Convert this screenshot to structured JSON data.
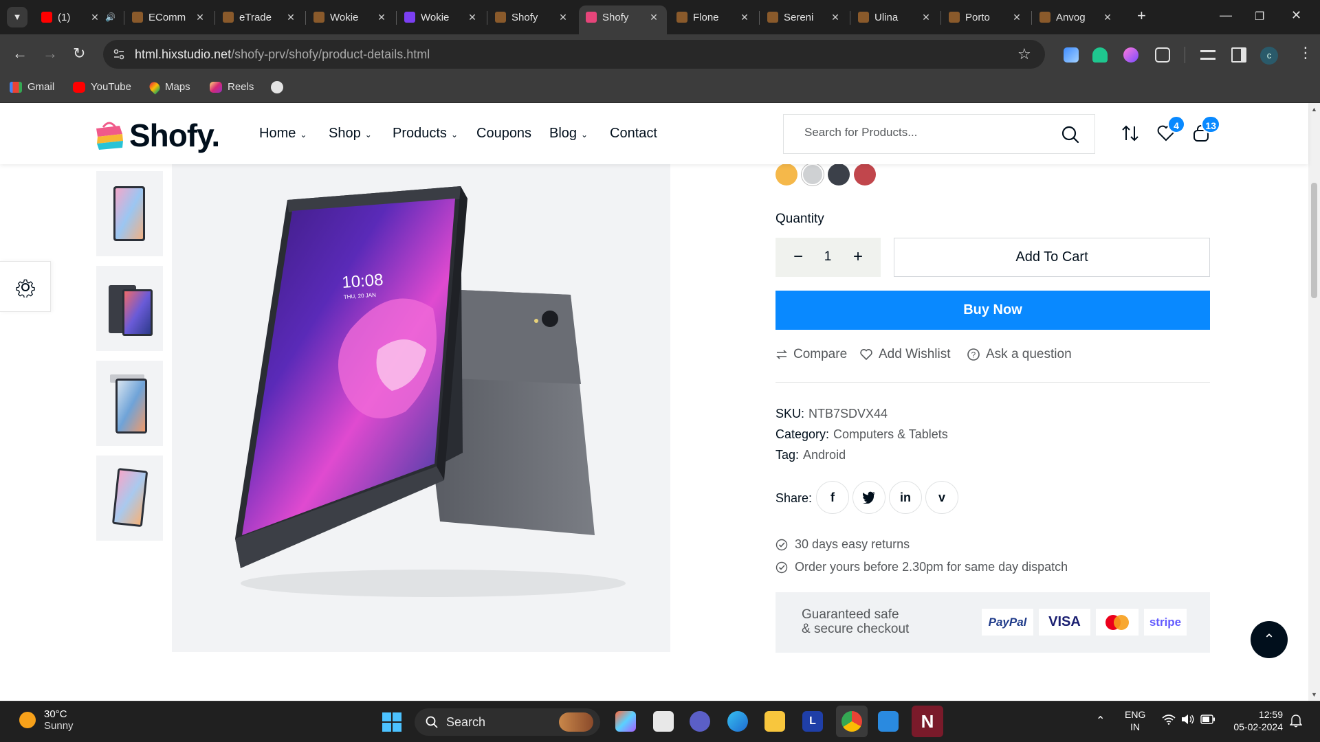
{
  "browser": {
    "tabs": [
      {
        "label": "(1)",
        "icon_color": "#ff0000"
      },
      {
        "label": "EComm",
        "icon_color": "#8a5a2b"
      },
      {
        "label": "eTrade",
        "icon_color": "#8a5a2b"
      },
      {
        "label": "Wokie",
        "icon_color": "#8a5a2b"
      },
      {
        "label": "Wokie",
        "icon_color": "#7b3ff2"
      },
      {
        "label": "Shofy",
        "icon_color": "#8a5a2b"
      },
      {
        "label": "Shofy",
        "icon_color": "#e6457a"
      },
      {
        "label": "Flone",
        "icon_color": "#8a5a2b"
      },
      {
        "label": "Sereni",
        "icon_color": "#8a5a2b"
      },
      {
        "label": "Ulina",
        "icon_color": "#8a5a2b"
      },
      {
        "label": "Porto",
        "icon_color": "#8a5a2b"
      },
      {
        "label": "Anvog",
        "icon_color": "#8a5a2b"
      }
    ],
    "url_host": "html.hixstudio.net",
    "url_path": "/shofy-prv/shofy/product-details.html",
    "profile_initial": "c",
    "bookmarks": [
      "Gmail",
      "YouTube",
      "Maps",
      "Reels"
    ]
  },
  "site": {
    "logo": "Shofy.",
    "nav": [
      "Home",
      "Shop",
      "Products",
      "Coupons",
      "Blog",
      "Contact"
    ],
    "search_placeholder": "Search for Products...",
    "wishlist_count": "4",
    "cart_count": "13"
  },
  "product": {
    "swatches": [
      "#f5b84a",
      "#cfd1d3",
      "#3b4049",
      "#c1464c"
    ],
    "quantity_label": "Quantity",
    "quantity": "1",
    "add_to_cart": "Add To Cart",
    "buy_now": "Buy Now",
    "actions": [
      "Compare",
      "Add Wishlist",
      "Ask a question"
    ],
    "sku_label": "SKU:",
    "sku": "NTB7SDVX44",
    "category_label": "Category:",
    "category": "Computers & Tablets",
    "tag_label": "Tag:",
    "tag": "Android",
    "share_label": "Share:",
    "policies": [
      "30 days easy returns",
      "Order yours before 2.30pm for same day dispatch"
    ],
    "checkout_line1": "Guaranteed safe",
    "checkout_line2": "& secure checkout",
    "payments": [
      "PayPal",
      "VISA",
      "",
      "stripe"
    ],
    "tablet_time": "10:08",
    "tablet_date": "THU, 20 JAN"
  },
  "taskbar": {
    "temperature": "30°C",
    "condition": "Sunny",
    "search_label": "Search",
    "lang1": "ENG",
    "lang2": "IN",
    "time": "12:59",
    "date": "05-02-2024"
  }
}
